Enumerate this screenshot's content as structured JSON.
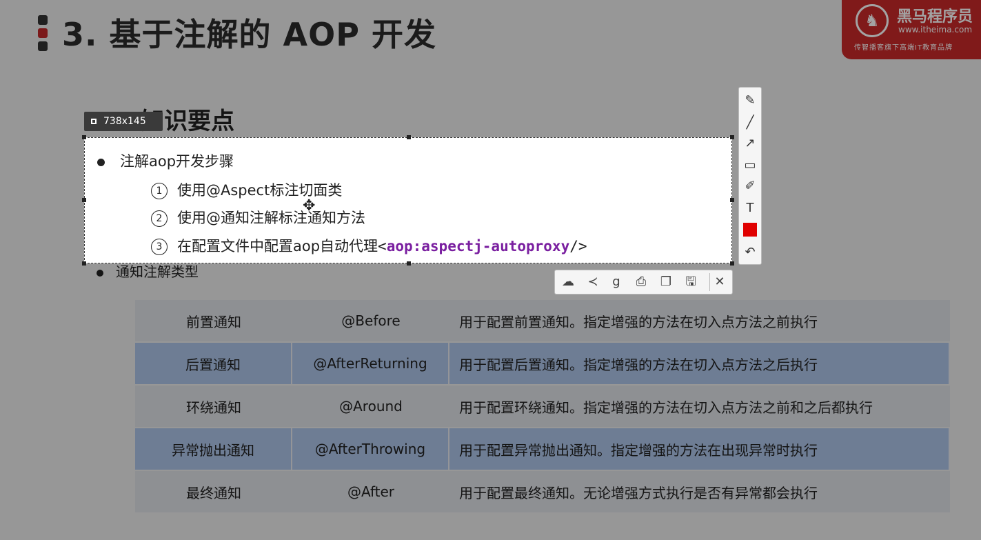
{
  "slide": {
    "title": "3. 基于注解的 AOP 开发",
    "subtitle": "3.3 知识要点",
    "logo": {
      "name": "黑马程序员",
      "url": "www.itheima.com",
      "tagline": "传智播客旗下高端IT教育品牌"
    },
    "section1": {
      "heading": "注解aop开发步骤",
      "steps": [
        {
          "num": "1",
          "text": "使用@Aspect标注切面类"
        },
        {
          "num": "2",
          "text": "使用@通知注解标注通知方法"
        },
        {
          "num": "3",
          "text": "在配置文件中配置aop自动代理",
          "code_open": "<",
          "code": "aop:aspectj-autoproxy",
          "code_close": "/>"
        }
      ]
    },
    "section2": {
      "heading": "通知注解类型"
    },
    "table": [
      {
        "name": "前置通知",
        "annotation": "@Before",
        "desc": "用于配置前置通知。指定增强的方法在切入点方法之前执行"
      },
      {
        "name": "后置通知",
        "annotation": "@AfterReturning",
        "desc": "用于配置后置通知。指定增强的方法在切入点方法之后执行"
      },
      {
        "name": "环绕通知",
        "annotation": "@Around",
        "desc": "用于配置环绕通知。指定增强的方法在切入点方法之前和之后都执行"
      },
      {
        "name": "异常抛出通知",
        "annotation": "@AfterThrowing",
        "desc": "用于配置异常抛出通知。指定增强的方法在出现异常时执行"
      },
      {
        "name": "最终通知",
        "annotation": "@After",
        "desc": "用于配置最终通知。无论增强方式执行是否有异常都会执行"
      }
    ]
  },
  "capture": {
    "size_label": "738x145",
    "draw_tools": [
      {
        "name": "pencil-icon",
        "glyph": "✎"
      },
      {
        "name": "line-icon",
        "glyph": "╱"
      },
      {
        "name": "arrow-icon",
        "glyph": "↗"
      },
      {
        "name": "rectangle-icon",
        "glyph": "▭"
      },
      {
        "name": "highlighter-icon",
        "glyph": "✐"
      },
      {
        "name": "text-icon",
        "glyph": "T"
      },
      {
        "name": "undo-icon",
        "glyph": "↶"
      }
    ],
    "color": "#e00000",
    "action_tools": [
      {
        "name": "cloud-upload-icon",
        "glyph": "☁"
      },
      {
        "name": "share-icon",
        "glyph": "≺"
      },
      {
        "name": "google-search-icon",
        "glyph": "g"
      },
      {
        "name": "print-icon",
        "glyph": "⎙"
      },
      {
        "name": "copy-icon",
        "glyph": "❐"
      },
      {
        "name": "save-icon",
        "glyph": "🖫"
      },
      {
        "name": "close-icon",
        "glyph": "✕"
      }
    ]
  },
  "colors": {
    "title_dot_top": "#333333",
    "title_dot_mid": "#c0282a",
    "title_dot_bottom": "#333333",
    "logo_red": "#c92a2a",
    "code_purple": "#7a1fa0"
  }
}
